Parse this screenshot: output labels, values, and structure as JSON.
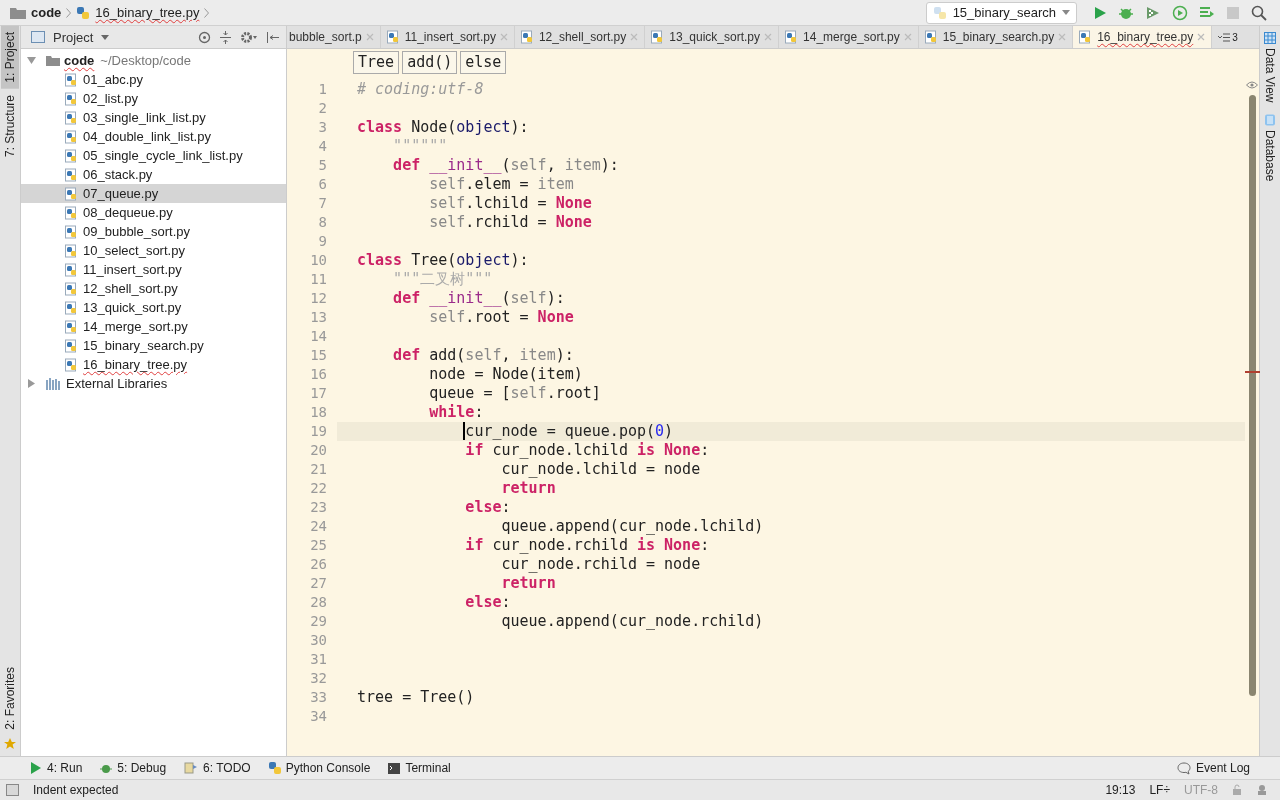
{
  "breadcrumbs": [
    "code",
    "16_binary_tree.py"
  ],
  "run_config": "15_binary_search",
  "left_strip": [
    {
      "label": "1: Project",
      "selected": true
    },
    {
      "label": "7: Structure",
      "selected": false
    }
  ],
  "left_strip_bottom": "2: Favorites",
  "right_strip": [
    "Data View",
    "Database"
  ],
  "project_panel": {
    "title": "Project",
    "root": {
      "name": "code",
      "path": "~/Desktop/code",
      "expanded": true,
      "children": [
        {
          "name": "01_abc.py",
          "selected": false
        },
        {
          "name": "02_list.py",
          "selected": false
        },
        {
          "name": "03_single_link_list.py",
          "selected": false
        },
        {
          "name": "04_double_link_list.py",
          "selected": false
        },
        {
          "name": "05_single_cycle_link_list.py",
          "selected": false
        },
        {
          "name": "06_stack.py",
          "selected": false
        },
        {
          "name": "07_queue.py",
          "selected": true
        },
        {
          "name": "08_dequeue.py",
          "selected": false
        },
        {
          "name": "09_bubble_sort.py",
          "selected": false
        },
        {
          "name": "10_select_sort.py",
          "selected": false
        },
        {
          "name": "11_insert_sort.py",
          "selected": false
        },
        {
          "name": "12_shell_sort.py",
          "selected": false
        },
        {
          "name": "13_quick_sort.py",
          "selected": false
        },
        {
          "name": "14_merge_sort.py",
          "selected": false
        },
        {
          "name": "15_binary_search.py",
          "selected": false
        },
        {
          "name": "16_binary_tree.py",
          "selected": false
        }
      ]
    },
    "libraries": {
      "name": "External Libraries",
      "expanded": false
    }
  },
  "tabs": [
    {
      "label": "bubble_sort.p",
      "selected": false,
      "icon": false
    },
    {
      "label": "11_insert_sort.py",
      "selected": false,
      "icon": true
    },
    {
      "label": "12_shell_sort.py",
      "selected": false,
      "icon": true
    },
    {
      "label": "13_quick_sort.py",
      "selected": false,
      "icon": true
    },
    {
      "label": "14_merge_sort.py",
      "selected": false,
      "icon": true
    },
    {
      "label": "15_binary_search.py",
      "selected": false,
      "icon": true
    },
    {
      "label": "16_binary_tree.py",
      "selected": true,
      "icon": true
    }
  ],
  "tab_overflow": "3",
  "editor_breadcrumbs": [
    "Tree",
    "add()",
    "else"
  ],
  "code": [
    {
      "no": "1",
      "current": false,
      "tokens": [
        {
          "kind": "comment",
          "text": "# coding:utf-8"
        }
      ]
    },
    {
      "no": "2",
      "current": false
    },
    {
      "no": "3",
      "current": false,
      "tokens": [
        {
          "kind": "kw",
          "text": "class"
        },
        {
          "kind": "plain",
          "text": " Node("
        },
        {
          "kind": "builtin",
          "text": "object"
        },
        {
          "kind": "plain",
          "text": "):"
        }
      ],
      "children": [
        {
          "no": "4",
          "current": false,
          "tokens": [
            {
              "kind": "doc",
              "text": "\"\"\"\"\"\""
            }
          ]
        },
        {
          "no": "5",
          "current": false,
          "tokens": [
            {
              "kind": "kw",
              "text": "def "
            },
            {
              "kind": "magic",
              "text": "__init__"
            },
            {
              "kind": "plain",
              "text": "("
            },
            {
              "kind": "self",
              "text": "self"
            },
            {
              "kind": "plain",
              "text": ", "
            },
            {
              "kind": "self",
              "text": "item"
            },
            {
              "kind": "plain",
              "text": "):"
            }
          ],
          "children": [
            {
              "no": "6",
              "current": false,
              "tokens": [
                {
                  "kind": "self",
                  "text": "self"
                },
                {
                  "kind": "plain",
                  "text": ".elem = "
                },
                {
                  "kind": "self",
                  "text": "item"
                }
              ]
            },
            {
              "no": "7",
              "current": false,
              "tokens": [
                {
                  "kind": "self",
                  "text": "self"
                },
                {
                  "kind": "plain",
                  "text": ".lchild = "
                },
                {
                  "kind": "const",
                  "text": "None"
                }
              ]
            },
            {
              "no": "8",
              "current": false,
              "tokens": [
                {
                  "kind": "self",
                  "text": "self"
                },
                {
                  "kind": "plain",
                  "text": ".rchild = "
                },
                {
                  "kind": "const",
                  "text": "None"
                }
              ]
            }
          ]
        }
      ]
    },
    {
      "no": "9",
      "current": false
    },
    {
      "no": "10",
      "current": false,
      "tokens": [
        {
          "kind": "kw",
          "text": "class"
        },
        {
          "kind": "plain",
          "text": " Tree("
        },
        {
          "kind": "builtin",
          "text": "object"
        },
        {
          "kind": "plain",
          "text": "):"
        }
      ],
      "children": [
        {
          "no": "11",
          "current": false,
          "tokens": [
            {
              "kind": "doc",
              "text": "\"\"\"二叉树\"\"\""
            }
          ]
        },
        {
          "no": "12",
          "current": false,
          "tokens": [
            {
              "kind": "kw",
              "text": "def "
            },
            {
              "kind": "magic",
              "text": "__init__"
            },
            {
              "kind": "plain",
              "text": "("
            },
            {
              "kind": "self",
              "text": "self"
            },
            {
              "kind": "plain",
              "text": "):"
            }
          ],
          "children": [
            {
              "no": "13",
              "current": false,
              "tokens": [
                {
                  "kind": "self",
                  "text": "self"
                },
                {
                  "kind": "plain",
                  "text": ".root = "
                },
                {
                  "kind": "const",
                  "text": "None"
                }
              ]
            }
          ]
        },
        {
          "no": "14",
          "current": false
        },
        {
          "no": "15",
          "current": false,
          "tokens": [
            {
              "kind": "kw",
              "text": "def"
            },
            {
              "kind": "plain",
              "text": " add("
            },
            {
              "kind": "self",
              "text": "self"
            },
            {
              "kind": "plain",
              "text": ", "
            },
            {
              "kind": "self",
              "text": "item"
            },
            {
              "kind": "plain",
              "text": "):"
            }
          ],
          "children": [
            {
              "no": "16",
              "current": false,
              "tokens": [
                {
                  "kind": "plain",
                  "text": "node = Node(item)"
                }
              ]
            },
            {
              "no": "17",
              "current": false,
              "tokens": [
                {
                  "kind": "plain",
                  "text": "queue = ["
                },
                {
                  "kind": "self",
                  "text": "self"
                },
                {
                  "kind": "plain",
                  "text": ".root]"
                }
              ]
            },
            {
              "no": "18",
              "current": false,
              "tokens": [
                {
                  "kind": "kw",
                  "text": "while"
                },
                {
                  "kind": "plain",
                  "text": ":"
                }
              ],
              "children": [
                {
                  "no": "19",
                  "current": true,
                  "tokens": [
                    {
                      "kind": "plain",
                      "text": "cur_node = queue.pop("
                    },
                    {
                      "kind": "num",
                      "text": "0"
                    },
                    {
                      "kind": "plain",
                      "text": ")"
                    }
                  ]
                },
                {
                  "no": "20",
                  "current": false,
                  "tokens": [
                    {
                      "kind": "kw",
                      "text": "if"
                    },
                    {
                      "kind": "plain",
                      "text": " cur_node.lchild "
                    },
                    {
                      "kind": "kw",
                      "text": "is "
                    },
                    {
                      "kind": "const",
                      "text": "None"
                    },
                    {
                      "kind": "plain",
                      "text": ":"
                    }
                  ],
                  "children": [
                    {
                      "no": "21",
                      "current": false,
                      "tokens": [
                        {
                          "kind": "plain",
                          "text": "cur_node.lchild = node"
                        }
                      ]
                    },
                    {
                      "no": "22",
                      "current": false,
                      "tokens": [
                        {
                          "kind": "kw",
                          "text": "return"
                        }
                      ]
                    }
                  ]
                },
                {
                  "no": "23",
                  "current": false,
                  "tokens": [
                    {
                      "kind": "kw",
                      "text": "else"
                    },
                    {
                      "kind": "plain",
                      "text": ":"
                    }
                  ],
                  "children": [
                    {
                      "no": "24",
                      "current": false,
                      "tokens": [
                        {
                          "kind": "plain",
                          "text": "queue.append(cur_node.lchild)"
                        }
                      ]
                    }
                  ]
                },
                {
                  "no": "25",
                  "current": false,
                  "tokens": [
                    {
                      "kind": "kw",
                      "text": "if"
                    },
                    {
                      "kind": "plain",
                      "text": " cur_node.rchild "
                    },
                    {
                      "kind": "kw",
                      "text": "is "
                    },
                    {
                      "kind": "const",
                      "text": "None"
                    },
                    {
                      "kind": "plain",
                      "text": ":"
                    }
                  ],
                  "children": [
                    {
                      "no": "26",
                      "current": false,
                      "tokens": [
                        {
                          "kind": "plain",
                          "text": "cur_node.rchild = node"
                        }
                      ]
                    },
                    {
                      "no": "27",
                      "current": false,
                      "tokens": [
                        {
                          "kind": "kw",
                          "text": "return"
                        }
                      ]
                    }
                  ]
                },
                {
                  "no": "28",
                  "current": false,
                  "tokens": [
                    {
                      "kind": "kw",
                      "text": "else"
                    },
                    {
                      "kind": "plain",
                      "text": ":"
                    }
                  ],
                  "children": [
                    {
                      "no": "29",
                      "current": false,
                      "tokens": [
                        {
                          "kind": "plain",
                          "text": "queue.append(cur_node.rchild)"
                        }
                      ]
                    }
                  ]
                }
              ]
            }
          ]
        }
      ]
    },
    {
      "no": "30",
      "current": false
    },
    {
      "no": "31",
      "current": false
    },
    {
      "no": "32",
      "current": false
    },
    {
      "no": "33",
      "current": false,
      "tokens": [
        {
          "kind": "plain",
          "text": "tree = Tree()"
        }
      ]
    },
    {
      "no": "34",
      "current": false
    }
  ],
  "tool_buttons": [
    {
      "label": "4: Run",
      "kind": "run"
    },
    {
      "label": "5: Debug",
      "kind": "debug"
    },
    {
      "label": "6: TODO",
      "kind": "todo"
    },
    {
      "label": "Python Console",
      "kind": "console"
    },
    {
      "label": "Terminal",
      "kind": "terminal"
    }
  ],
  "event_log": "Event Log",
  "status": {
    "message": "Indent expected",
    "position": "19:13",
    "line_sep": "LF÷",
    "encoding": "UTF-8"
  }
}
